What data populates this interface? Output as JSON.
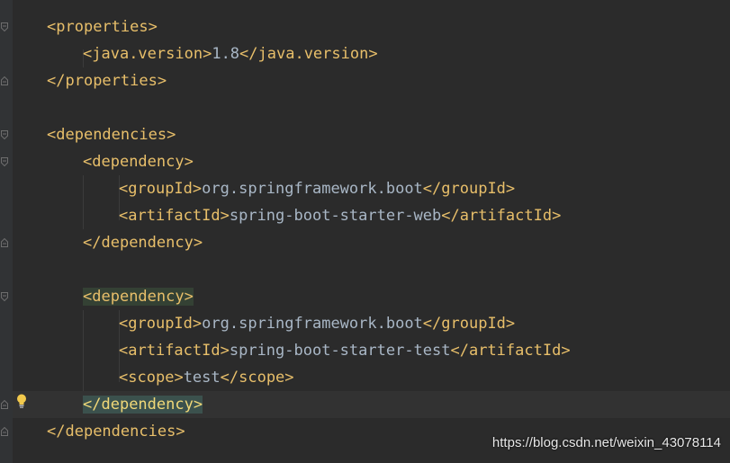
{
  "editor": {
    "lines": [
      {
        "open": "<",
        "name": "properties",
        "close": ">",
        "text": "",
        "end": ""
      },
      {
        "open": "<",
        "name": "java.version",
        "close": ">",
        "text": "1.8",
        "end": "</java.version>"
      },
      {
        "open": "</",
        "name": "properties",
        "close": ">",
        "text": "",
        "end": ""
      },
      {
        "open": "<",
        "name": "dependencies",
        "close": ">",
        "text": "",
        "end": ""
      },
      {
        "open": "<",
        "name": "dependency",
        "close": ">",
        "text": "",
        "end": ""
      },
      {
        "open": "<",
        "name": "groupId",
        "close": ">",
        "text": "org.springframework.boot",
        "end": "</groupId>"
      },
      {
        "open": "<",
        "name": "artifactId",
        "close": ">",
        "text": "spring-boot-starter-web",
        "end": "</artifactId>"
      },
      {
        "open": "</",
        "name": "dependency",
        "close": ">",
        "text": "",
        "end": ""
      },
      {
        "open": "<",
        "name": "dependency",
        "close": ">",
        "text": "",
        "end": ""
      },
      {
        "open": "<",
        "name": "groupId",
        "close": ">",
        "text": "org.springframework.boot",
        "end": "</groupId>"
      },
      {
        "open": "<",
        "name": "artifactId",
        "close": ">",
        "text": "spring-boot-starter-test",
        "end": "</artifactId>"
      },
      {
        "open": "<",
        "name": "scope",
        "close": ">",
        "text": "test",
        "end": "</scope>"
      },
      {
        "open": "</",
        "name": "dependency",
        "close": ">",
        "text": "",
        "end": ""
      },
      {
        "open": "</",
        "name": "dependencies",
        "close": ">",
        "text": "",
        "end": ""
      }
    ]
  },
  "gutter": {
    "intention_icon": "lightbulb-icon",
    "fold_icon": "fold-marker-icon"
  },
  "watermark": "https://blog.csdn.net/weixin_43078114",
  "colors": {
    "background": "#2b2b2b",
    "tag": "#e8bf6a",
    "text": "#a9b7c6",
    "match_highlight": "#3b514d"
  }
}
